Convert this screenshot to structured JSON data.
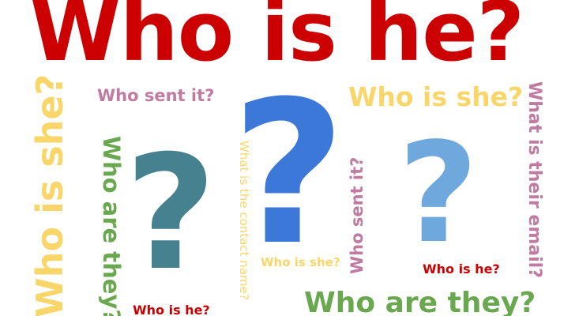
{
  "colors": {
    "red": "#cc0000",
    "yellow": "#f8d66a",
    "pink": "#c27ba0",
    "green": "#6aa84f",
    "teal": "#45818e",
    "blue": "#3c78d8",
    "light_blue": "#6fa8dc"
  },
  "phrases": {
    "title": "Who is he?",
    "who_is_she_big_vertical": "Who is she?",
    "who_sent_it_top": "Who sent it?",
    "who_is_she_top": "Who is she?",
    "what_is_their_email": "What is their email?",
    "who_are_they_vertical": "Who are they?",
    "what_is_contact_name": "What is the contact name?",
    "who_sent_it_vertical": "Who sent it?",
    "who_is_she_small": "Who is she?",
    "who_is_he_right": "Who is he?",
    "who_is_he_bottom": "Who is he?",
    "who_are_they_bottom": "Who are they?"
  },
  "question_marks": {
    "glyph": "?"
  }
}
